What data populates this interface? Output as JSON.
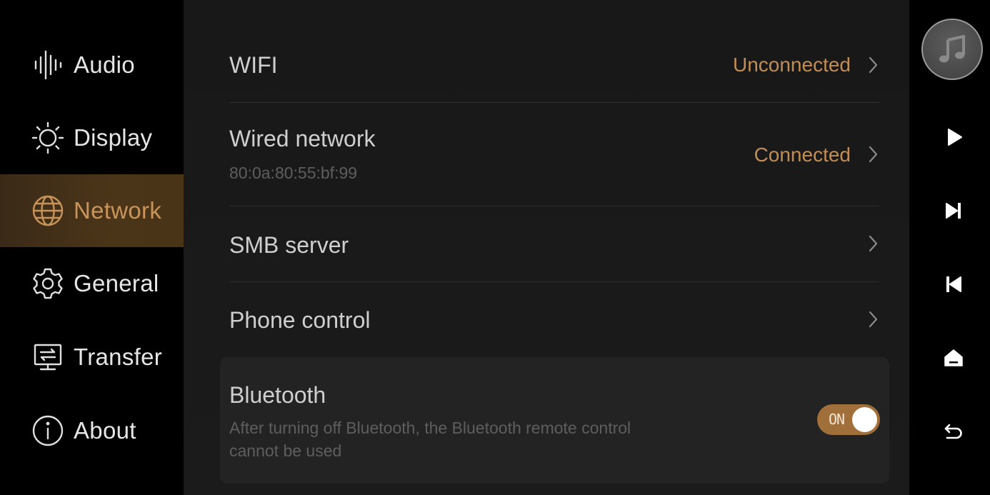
{
  "sidebar": {
    "items": [
      {
        "label": "Audio",
        "icon": "audio-waveform-icon",
        "active": false
      },
      {
        "label": "Display",
        "icon": "sun-icon",
        "active": false
      },
      {
        "label": "Network",
        "icon": "globe-icon",
        "active": true
      },
      {
        "label": "General",
        "icon": "gear-icon",
        "active": false
      },
      {
        "label": "Transfer",
        "icon": "transfer-monitor-icon",
        "active": false
      },
      {
        "label": "About",
        "icon": "info-icon",
        "active": false
      }
    ]
  },
  "main": {
    "wifi": {
      "title": "WIFI",
      "status": "Unconnected"
    },
    "wired": {
      "title": "Wired network",
      "subtitle": "80:0a:80:55:bf:99",
      "status": "Connected"
    },
    "smb": {
      "title": "SMB server"
    },
    "phone": {
      "title": "Phone control"
    },
    "bluetooth": {
      "title": "Bluetooth",
      "description_line1": "After turning off Bluetooth, the Bluetooth remote control",
      "description_line2": "cannot be used",
      "toggle_label": "ON",
      "enabled": true
    }
  },
  "rightbar": {
    "album_icon": "music-note-icon",
    "controls": [
      "play-icon",
      "next-track-icon",
      "previous-track-icon",
      "home-icon",
      "back-icon"
    ]
  },
  "colors": {
    "accent": "#c28d55",
    "active_bg": "#4b3519",
    "toggle_on": "#a06f3a",
    "text_primary": "#cfcfcf",
    "text_secondary": "#5e5e5e"
  }
}
